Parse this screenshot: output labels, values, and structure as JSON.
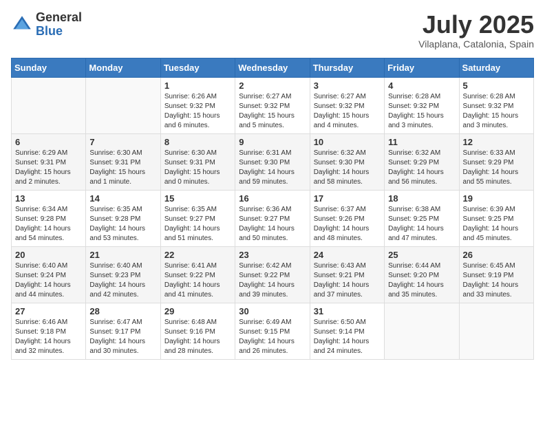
{
  "logo": {
    "general": "General",
    "blue": "Blue"
  },
  "title": "July 2025",
  "subtitle": "Vilaplana, Catalonia, Spain",
  "headers": [
    "Sunday",
    "Monday",
    "Tuesday",
    "Wednesday",
    "Thursday",
    "Friday",
    "Saturday"
  ],
  "weeks": [
    [
      {
        "day": "",
        "sunrise": "",
        "sunset": "",
        "daylight": ""
      },
      {
        "day": "",
        "sunrise": "",
        "sunset": "",
        "daylight": ""
      },
      {
        "day": "1",
        "sunrise": "Sunrise: 6:26 AM",
        "sunset": "Sunset: 9:32 PM",
        "daylight": "Daylight: 15 hours and 6 minutes."
      },
      {
        "day": "2",
        "sunrise": "Sunrise: 6:27 AM",
        "sunset": "Sunset: 9:32 PM",
        "daylight": "Daylight: 15 hours and 5 minutes."
      },
      {
        "day": "3",
        "sunrise": "Sunrise: 6:27 AM",
        "sunset": "Sunset: 9:32 PM",
        "daylight": "Daylight: 15 hours and 4 minutes."
      },
      {
        "day": "4",
        "sunrise": "Sunrise: 6:28 AM",
        "sunset": "Sunset: 9:32 PM",
        "daylight": "Daylight: 15 hours and 3 minutes."
      },
      {
        "day": "5",
        "sunrise": "Sunrise: 6:28 AM",
        "sunset": "Sunset: 9:32 PM",
        "daylight": "Daylight: 15 hours and 3 minutes."
      }
    ],
    [
      {
        "day": "6",
        "sunrise": "Sunrise: 6:29 AM",
        "sunset": "Sunset: 9:31 PM",
        "daylight": "Daylight: 15 hours and 2 minutes."
      },
      {
        "day": "7",
        "sunrise": "Sunrise: 6:30 AM",
        "sunset": "Sunset: 9:31 PM",
        "daylight": "Daylight: 15 hours and 1 minute."
      },
      {
        "day": "8",
        "sunrise": "Sunrise: 6:30 AM",
        "sunset": "Sunset: 9:31 PM",
        "daylight": "Daylight: 15 hours and 0 minutes."
      },
      {
        "day": "9",
        "sunrise": "Sunrise: 6:31 AM",
        "sunset": "Sunset: 9:30 PM",
        "daylight": "Daylight: 14 hours and 59 minutes."
      },
      {
        "day": "10",
        "sunrise": "Sunrise: 6:32 AM",
        "sunset": "Sunset: 9:30 PM",
        "daylight": "Daylight: 14 hours and 58 minutes."
      },
      {
        "day": "11",
        "sunrise": "Sunrise: 6:32 AM",
        "sunset": "Sunset: 9:29 PM",
        "daylight": "Daylight: 14 hours and 56 minutes."
      },
      {
        "day": "12",
        "sunrise": "Sunrise: 6:33 AM",
        "sunset": "Sunset: 9:29 PM",
        "daylight": "Daylight: 14 hours and 55 minutes."
      }
    ],
    [
      {
        "day": "13",
        "sunrise": "Sunrise: 6:34 AM",
        "sunset": "Sunset: 9:28 PM",
        "daylight": "Daylight: 14 hours and 54 minutes."
      },
      {
        "day": "14",
        "sunrise": "Sunrise: 6:35 AM",
        "sunset": "Sunset: 9:28 PM",
        "daylight": "Daylight: 14 hours and 53 minutes."
      },
      {
        "day": "15",
        "sunrise": "Sunrise: 6:35 AM",
        "sunset": "Sunset: 9:27 PM",
        "daylight": "Daylight: 14 hours and 51 minutes."
      },
      {
        "day": "16",
        "sunrise": "Sunrise: 6:36 AM",
        "sunset": "Sunset: 9:27 PM",
        "daylight": "Daylight: 14 hours and 50 minutes."
      },
      {
        "day": "17",
        "sunrise": "Sunrise: 6:37 AM",
        "sunset": "Sunset: 9:26 PM",
        "daylight": "Daylight: 14 hours and 48 minutes."
      },
      {
        "day": "18",
        "sunrise": "Sunrise: 6:38 AM",
        "sunset": "Sunset: 9:25 PM",
        "daylight": "Daylight: 14 hours and 47 minutes."
      },
      {
        "day": "19",
        "sunrise": "Sunrise: 6:39 AM",
        "sunset": "Sunset: 9:25 PM",
        "daylight": "Daylight: 14 hours and 45 minutes."
      }
    ],
    [
      {
        "day": "20",
        "sunrise": "Sunrise: 6:40 AM",
        "sunset": "Sunset: 9:24 PM",
        "daylight": "Daylight: 14 hours and 44 minutes."
      },
      {
        "day": "21",
        "sunrise": "Sunrise: 6:40 AM",
        "sunset": "Sunset: 9:23 PM",
        "daylight": "Daylight: 14 hours and 42 minutes."
      },
      {
        "day": "22",
        "sunrise": "Sunrise: 6:41 AM",
        "sunset": "Sunset: 9:22 PM",
        "daylight": "Daylight: 14 hours and 41 minutes."
      },
      {
        "day": "23",
        "sunrise": "Sunrise: 6:42 AM",
        "sunset": "Sunset: 9:22 PM",
        "daylight": "Daylight: 14 hours and 39 minutes."
      },
      {
        "day": "24",
        "sunrise": "Sunrise: 6:43 AM",
        "sunset": "Sunset: 9:21 PM",
        "daylight": "Daylight: 14 hours and 37 minutes."
      },
      {
        "day": "25",
        "sunrise": "Sunrise: 6:44 AM",
        "sunset": "Sunset: 9:20 PM",
        "daylight": "Daylight: 14 hours and 35 minutes."
      },
      {
        "day": "26",
        "sunrise": "Sunrise: 6:45 AM",
        "sunset": "Sunset: 9:19 PM",
        "daylight": "Daylight: 14 hours and 33 minutes."
      }
    ],
    [
      {
        "day": "27",
        "sunrise": "Sunrise: 6:46 AM",
        "sunset": "Sunset: 9:18 PM",
        "daylight": "Daylight: 14 hours and 32 minutes."
      },
      {
        "day": "28",
        "sunrise": "Sunrise: 6:47 AM",
        "sunset": "Sunset: 9:17 PM",
        "daylight": "Daylight: 14 hours and 30 minutes."
      },
      {
        "day": "29",
        "sunrise": "Sunrise: 6:48 AM",
        "sunset": "Sunset: 9:16 PM",
        "daylight": "Daylight: 14 hours and 28 minutes."
      },
      {
        "day": "30",
        "sunrise": "Sunrise: 6:49 AM",
        "sunset": "Sunset: 9:15 PM",
        "daylight": "Daylight: 14 hours and 26 minutes."
      },
      {
        "day": "31",
        "sunrise": "Sunrise: 6:50 AM",
        "sunset": "Sunset: 9:14 PM",
        "daylight": "Daylight: 14 hours and 24 minutes."
      },
      {
        "day": "",
        "sunrise": "",
        "sunset": "",
        "daylight": ""
      },
      {
        "day": "",
        "sunrise": "",
        "sunset": "",
        "daylight": ""
      }
    ]
  ]
}
